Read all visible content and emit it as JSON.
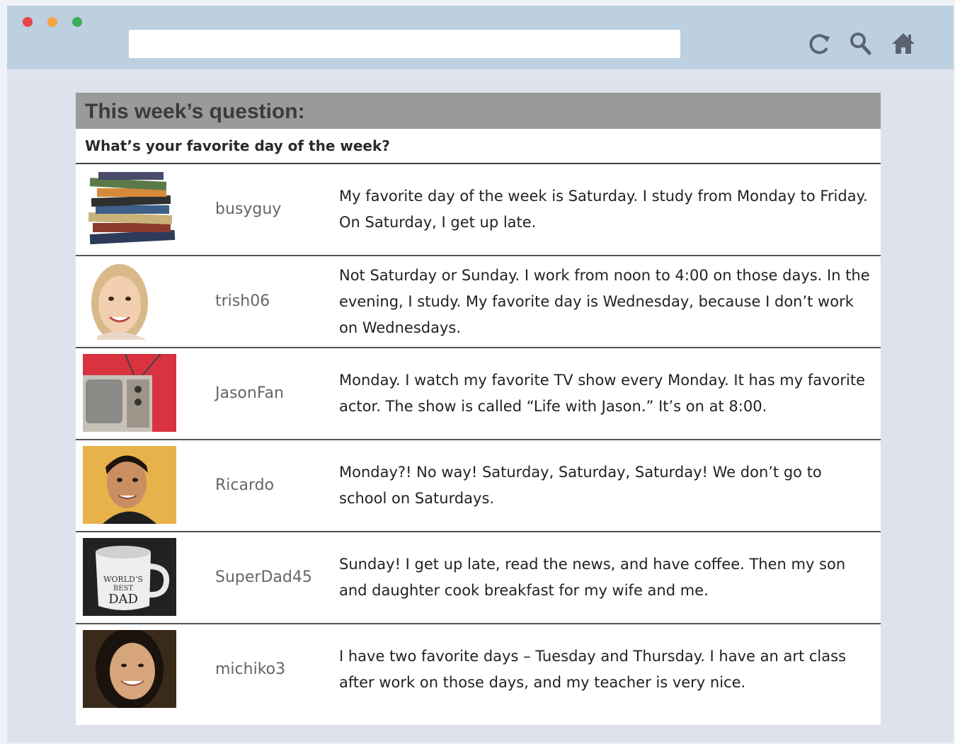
{
  "browser": {
    "window_controls": [
      "close",
      "minimize",
      "maximize"
    ],
    "url_value": "",
    "toolbar_icons": [
      "refresh-icon",
      "search-icon",
      "home-icon"
    ]
  },
  "forum": {
    "header": "This week’s question:",
    "question": "What’s your favorite day of the week?",
    "posts": [
      {
        "username": "busyguy",
        "avatar": "stack-of-books",
        "message": "My favorite day of the week is Saturday. I study from Monday to Friday. On Saturday, I get up late."
      },
      {
        "username": "trish06",
        "avatar": "smiling-woman-portrait",
        "message": "Not Saturday or Sunday. I work from noon to 4:00 on those days. In the evening, I study. My favorite day is Wednesday, because I don’t work on Wednesdays."
      },
      {
        "username": "JasonFan",
        "avatar": "retro-television",
        "message": "Monday. I watch my favorite TV show every Monday. It has my favorite actor. The show is called “Life with Jason.” It’s on at 8:00."
      },
      {
        "username": "Ricardo",
        "avatar": "smiling-man-portrait",
        "message": "Monday?! No way! Saturday, Saturday, Saturday! We don’t go to school on Saturdays."
      },
      {
        "username": "SuperDad45",
        "avatar": "coffee-mug",
        "mug_text": [
          "WORLD’S",
          "BEST",
          "DAD"
        ],
        "message": "Sunday! I get up late, read the news, and have coffee. Then my son and daughter cook breakfast for my wife and me."
      },
      {
        "username": "michiko3",
        "avatar": "smiling-woman-portrait",
        "message": "I have two favorite days – Tuesday and Thursday. I have an art class after work on those days, and my teacher is very nice."
      }
    ]
  },
  "colors": {
    "topbar": "#bcd0e0",
    "header_bg": "#9a9a9a",
    "close": "#e8454a",
    "minimize": "#f2a540",
    "maximize": "#3fae5a"
  }
}
